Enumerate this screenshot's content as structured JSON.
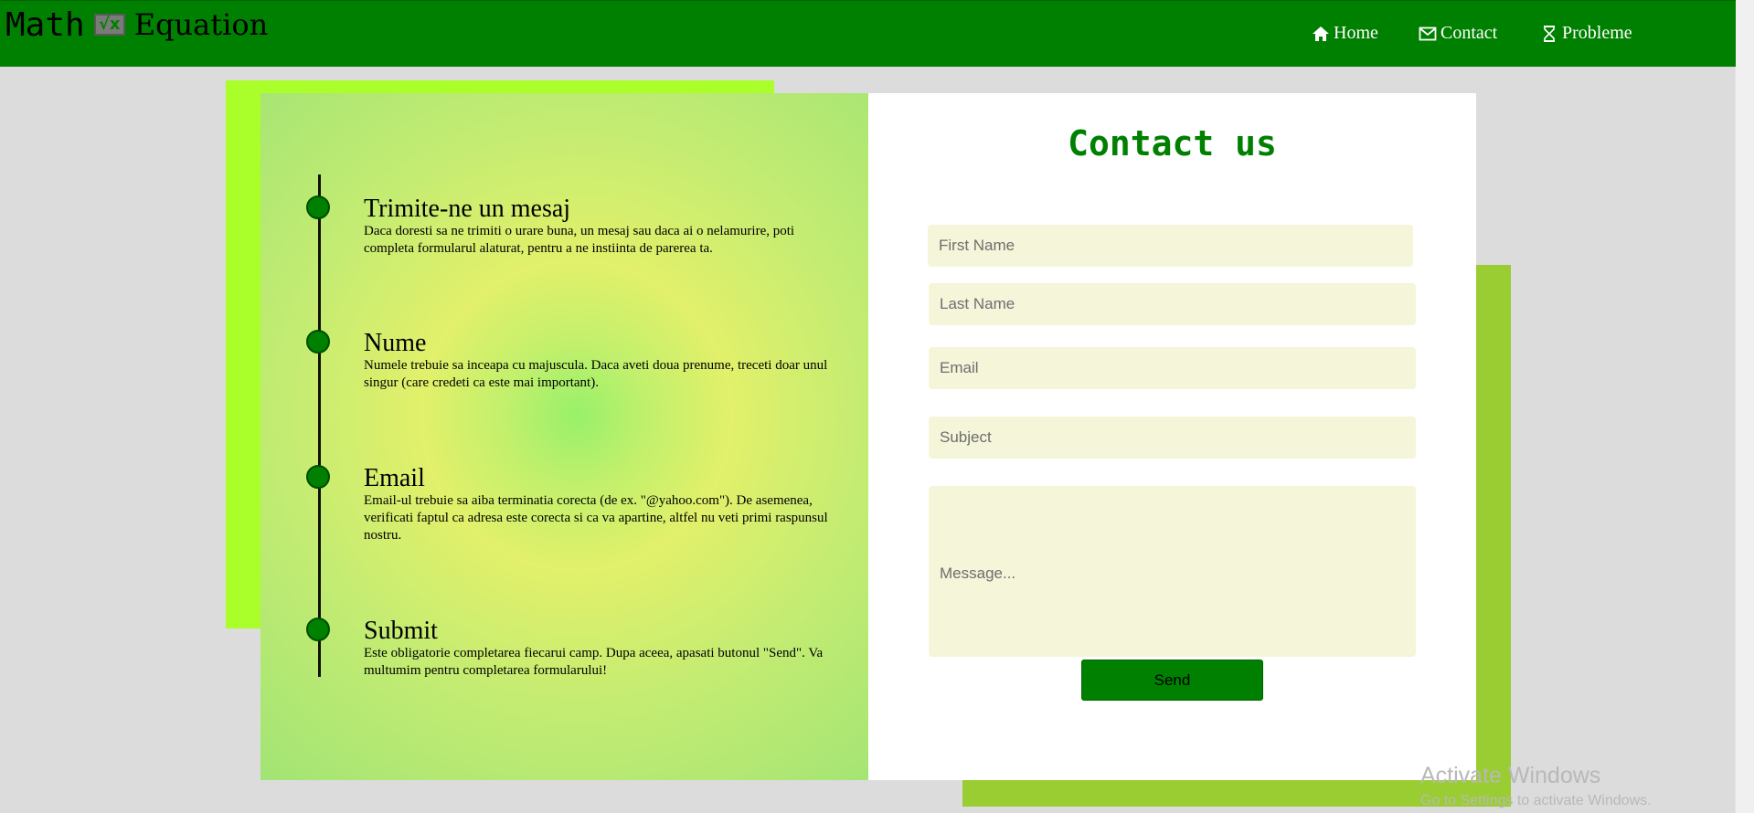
{
  "header": {
    "logo_text_1": "Math",
    "logo_icon": "√x",
    "logo_text_2": "Equation",
    "nav": [
      {
        "label": "Home",
        "icon": "home-icon"
      },
      {
        "label": "Contact",
        "icon": "envelope-icon"
      },
      {
        "label": "Probleme",
        "icon": "hourglass-icon"
      }
    ]
  },
  "info_steps": [
    {
      "title": "Trimite-ne un mesaj",
      "text": "Daca doresti sa ne trimiti o urare buna, un mesaj sau daca ai o nelamurire, poti completa formularul alaturat, pentru a ne instiinta de parerea ta."
    },
    {
      "title": "Nume",
      "text": "Numele trebuie sa inceapa cu majuscula. Daca aveti doua prenume, treceti doar unul singur (care credeti ca este mai important)."
    },
    {
      "title": "Email",
      "text": "Email-ul trebuie sa aiba terminatia corecta (de ex. \"@yahoo.com\"). De asemenea, verificati faptul ca adresa este corecta si ca va apartine, altfel nu veti primi raspunsul nostru."
    },
    {
      "title": "Submit",
      "text": "Este obligatorie completarea fiecarui camp. Dupa aceea, apasati butonul \"Send\". Va multumim pentru completarea formularului!"
    }
  ],
  "form": {
    "title": "Contact us",
    "first_name_placeholder": "First Name",
    "last_name_placeholder": "Last Name",
    "email_placeholder": "Email",
    "subject_placeholder": "Subject",
    "message_placeholder": "Message...",
    "send_label": "Send"
  },
  "watermark": {
    "line1": "Activate Windows",
    "line2": "Go to Settings to activate Windows."
  },
  "colors": {
    "header_bg": "#008000",
    "accent_lime": "#aaff2a",
    "accent_olive": "#9acd32",
    "field_bg": "#f4f5d9"
  }
}
